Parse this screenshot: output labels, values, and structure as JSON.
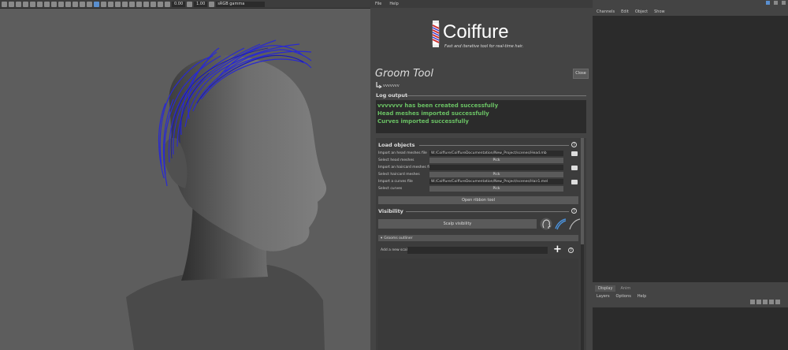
{
  "viewport": {
    "camera_near": "0.00",
    "camera_far": "1.00",
    "color_space": "sRGB gamma"
  },
  "menu": {
    "file": "File",
    "help": "Help"
  },
  "logo": {
    "name": "Coiffure",
    "tagline": "Fast and iterative tool for real-time hair."
  },
  "groom": {
    "title": "Groom Tool",
    "close": "Close",
    "name": "vvvvvvv"
  },
  "log": {
    "title": "Log output",
    "lines": [
      "vvvvvvv has been created successfully",
      "Head meshes imported successfully",
      "Curves imported successfully"
    ]
  },
  "load": {
    "title": "Load objects",
    "import_head_label": "Import an head meshes file",
    "import_head_path": "W:/Coiffure/CoiffureDocumentation/New_Project/scenes/Head.mb",
    "select_head_label": "Select head meshes",
    "pick1": "Pick",
    "import_haircard_label": "Import an haircard meshes file",
    "import_haircard_path": "",
    "select_haircard_label": "Select haircard meshes",
    "pick2": "Pick",
    "import_curves_label": "Import a curves file",
    "import_curves_path": "W:/Coiffure/CoiffureDocumentation/New_Project/scenes/Hair1.mel",
    "select_curves_label": "Select curves",
    "pick3": "Pick",
    "open_ribbon": "Open ribbon tool"
  },
  "visibility": {
    "title": "Visibility",
    "scalp_btn": "Scalp visibility"
  },
  "grooms": {
    "outliner": "Grooms outliner",
    "add_scalp_label": "Add a new scalp"
  },
  "channel_box": {
    "menus": [
      "Channels",
      "Edit",
      "Object",
      "Show"
    ]
  },
  "layers": {
    "tabs": [
      "Display",
      "Anim"
    ],
    "menus": [
      "Layers",
      "Options",
      "Help"
    ]
  }
}
